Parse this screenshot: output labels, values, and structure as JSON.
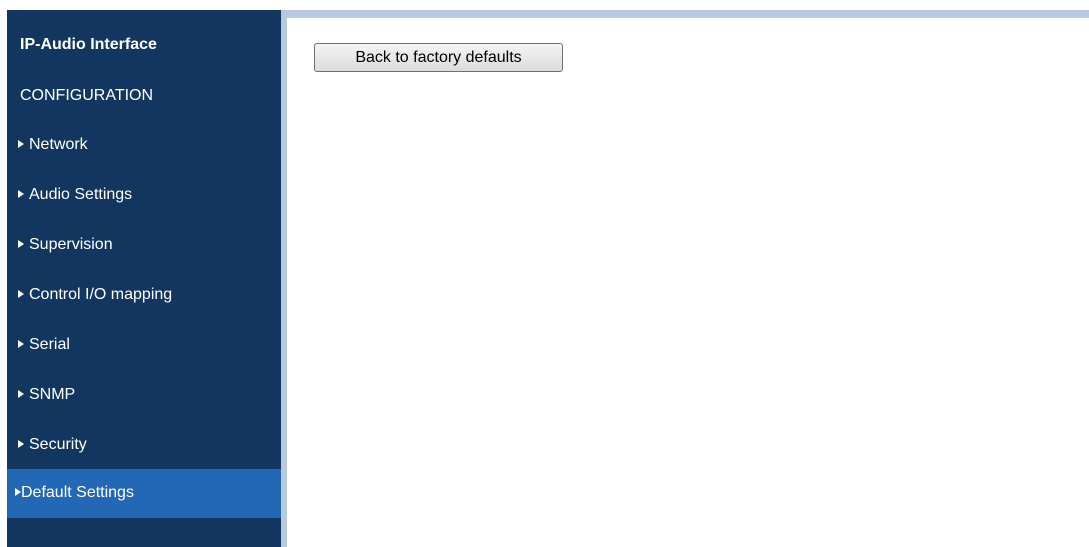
{
  "sidebar": {
    "app_title": "IP-Audio Interface",
    "section_title": "CONFIGURATION",
    "items": [
      {
        "label": "Network"
      },
      {
        "label": "Audio Settings"
      },
      {
        "label": "Supervision"
      },
      {
        "label": "Control I/O mapping"
      },
      {
        "label": "Serial"
      },
      {
        "label": "SNMP"
      },
      {
        "label": "Security"
      },
      {
        "label": "Default Settings",
        "active": true
      }
    ]
  },
  "main": {
    "factory_defaults_label": "Back to factory defaults"
  },
  "colors": {
    "sidebar_bg": "#12365f",
    "active_item_bg": "#2368b4",
    "frame_accent": "#b8c8de"
  }
}
